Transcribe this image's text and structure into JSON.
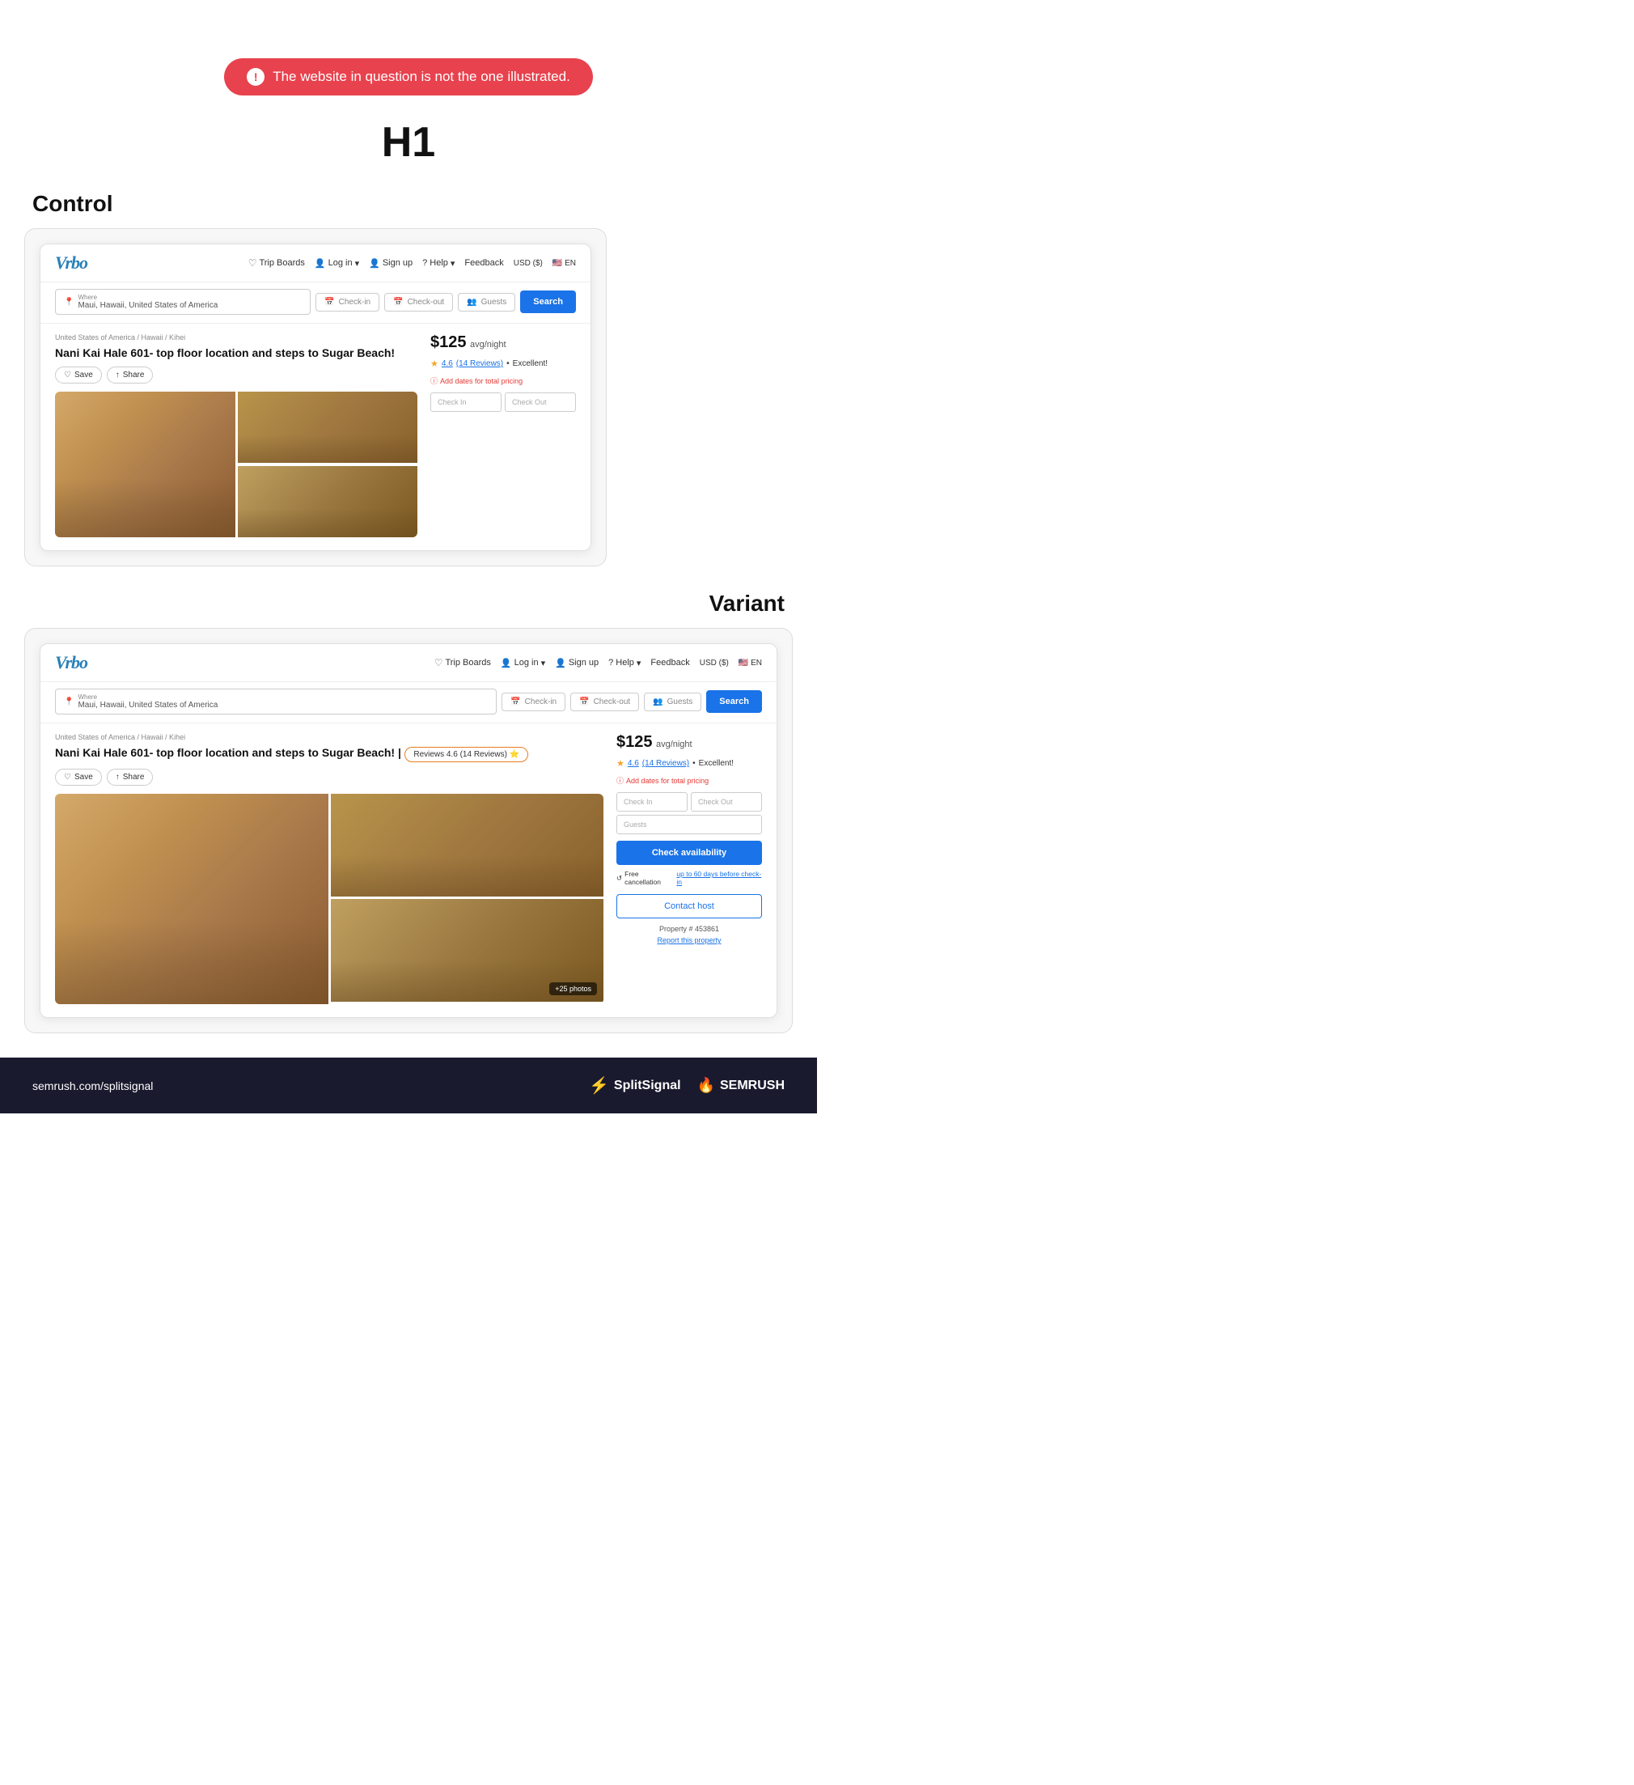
{
  "alert": {
    "icon": "!",
    "text": "The website in question is not the one illustrated."
  },
  "heading": "H1",
  "control": {
    "label": "Control",
    "vrbo_logo": "Vrbo",
    "nav": {
      "trip_boards": "Trip Boards",
      "log_in": "Log in",
      "sign_up": "Sign up",
      "help": "Help",
      "feedback": "Feedback",
      "currency": "USD ($)",
      "language": "EN"
    },
    "search": {
      "where_label": "Where",
      "where_value": "Maui, Hawaii, United States of America",
      "checkin": "Check-in",
      "checkout": "Check-out",
      "guests": "Guests",
      "button": "Search"
    },
    "breadcrumb": "United States of America / Hawaii / Kihei",
    "title": "Nani Kai Hale 601- top floor location and steps to Sugar Beach!",
    "save": "Save",
    "share": "Share",
    "price": "$125",
    "price_unit": "avg/night",
    "rating": "4.6",
    "reviews_count": "(14 Reviews)",
    "excellent": "Excellent!",
    "add_dates": "Add dates for total pricing",
    "checkin_placeholder": "Check In",
    "checkout_placeholder": "Check Out"
  },
  "variant": {
    "label": "Variant",
    "vrbo_logo": "Vrbo",
    "nav": {
      "trip_boards": "Trip Boards",
      "log_in": "Log in",
      "sign_up": "Sign up",
      "help": "Help",
      "feedback": "Feedback",
      "currency": "USD ($)",
      "language": "EN"
    },
    "search": {
      "where_label": "Where",
      "where_value": "Maui, Hawaii, United States of America",
      "checkin": "Check-in",
      "checkout": "Check-out",
      "guests": "Guests",
      "button": "Search"
    },
    "breadcrumb": "United States of America / Hawaii / Kihei",
    "title": "Nani Kai Hale 601- top floor location and steps to Sugar Beach! |",
    "reviews_badge": "Reviews 4.6 (14 Reviews) ⭐",
    "save": "Save",
    "share": "Share",
    "price": "$125",
    "price_unit": "avg/night",
    "rating": "4.6",
    "reviews_count": "(14 Reviews)",
    "excellent": "Excellent!",
    "add_dates": "Add dates for total pricing",
    "checkin_placeholder": "Check In",
    "checkout_placeholder": "Check Out",
    "guests_placeholder": "Guests",
    "check_availability": "Check availability",
    "free_cancellation_text": "Free cancellation",
    "free_cancellation_detail": "up to 60 days before check-in",
    "contact_host": "Contact host",
    "property_num_label": "Property #",
    "property_num": "453861",
    "report": "Report this property",
    "photos_count": "+25 photos"
  },
  "footer": {
    "left_text": "semrush.com/splitsignal",
    "splitsignal_label": "SplitSignal",
    "semrush_label": "SEMRUSH"
  }
}
